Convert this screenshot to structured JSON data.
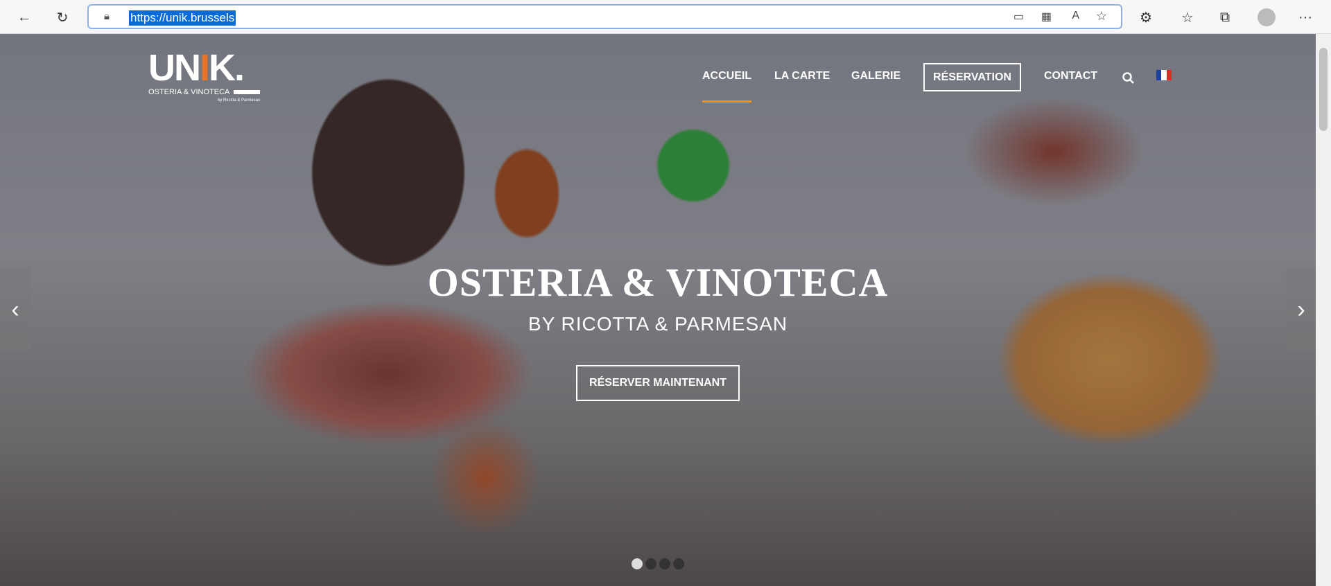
{
  "browser": {
    "url": "https://unik.brussels",
    "more": "···"
  },
  "logo": {
    "name_a": "UN",
    "name_i": "I",
    "name_b": "K.",
    "tagline": "OSTERIA & VINOTECA",
    "by": "by Ricotta & Parmesan"
  },
  "nav": {
    "items": [
      "ACCUEIL",
      "LA CARTE",
      "GALERIE",
      "RÉSERVATION",
      "CONTACT"
    ]
  },
  "hero": {
    "title": "OSTERIA & VINOTECA",
    "subtitle": "BY RICOTTA & PARMESAN",
    "cta": "RÉSERVER MAINTENANT",
    "slides": 4,
    "active_slide": 1
  },
  "colors": {
    "accent": "#f0931e"
  }
}
